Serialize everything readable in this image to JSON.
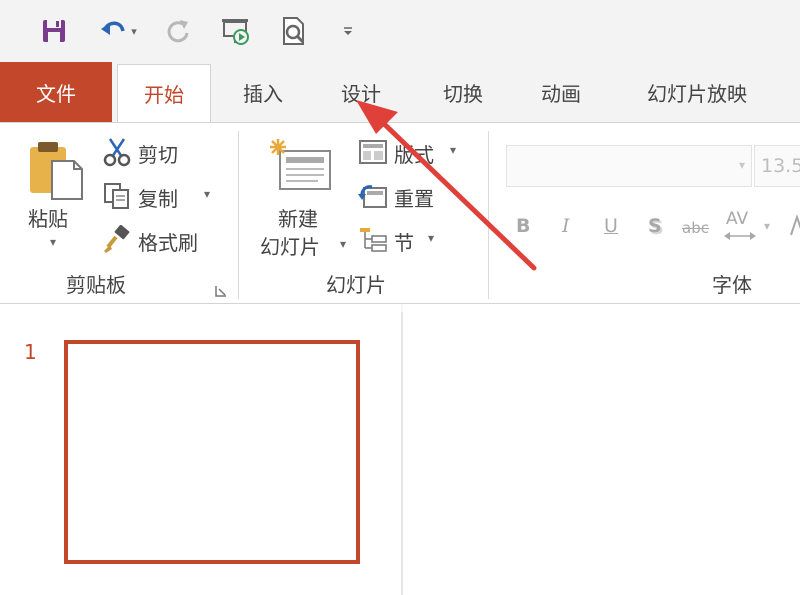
{
  "qat": {
    "icons": [
      "save-icon",
      "undo-icon",
      "redo-icon",
      "present-from-start-icon",
      "print-preview-icon",
      "customize-qat-icon"
    ]
  },
  "tabs": {
    "file": "文件",
    "home": "开始",
    "insert": "插入",
    "design": "设计",
    "transitions": "切换",
    "animations": "动画",
    "slideshow": "幻灯片放映"
  },
  "clipboard": {
    "paste": "粘贴",
    "cut": "剪切",
    "copy": "复制",
    "format_painter": "格式刷",
    "group_label": "剪贴板"
  },
  "slides": {
    "new_slide_line1": "新建",
    "new_slide_line2": "幻灯片",
    "layout": "版式",
    "reset": "重置",
    "section": "节",
    "group_label": "幻灯片"
  },
  "font": {
    "font_name_value": "",
    "font_size_value": "13.5",
    "bold": "B",
    "italic": "I",
    "underline": "U",
    "shadow": "S",
    "strikethrough": "abc",
    "char_spacing": "AV",
    "group_label": "字体"
  },
  "thumbnails": {
    "slide_number": "1"
  },
  "colors": {
    "accent": "#c3472b",
    "ribbon_bg": "#f3f3f3"
  }
}
